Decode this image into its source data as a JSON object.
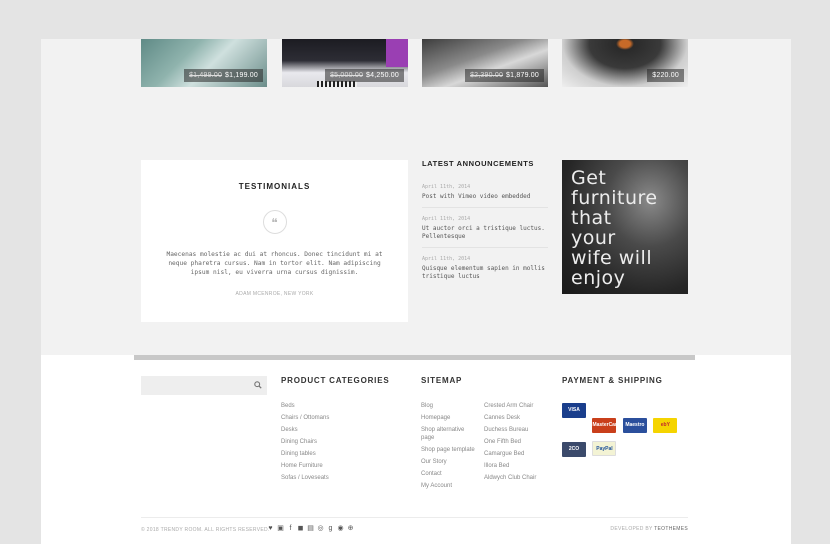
{
  "products": [
    {
      "old_price": "$1,499.00",
      "price": "$1,199.00"
    },
    {
      "old_price": "$5,000.00",
      "price": "$4,250.00"
    },
    {
      "old_price": "$2,390.00",
      "price": "$1,879.00"
    },
    {
      "old_price": "",
      "price": "$220.00"
    }
  ],
  "testimonials": {
    "title": "TESTIMONIALS",
    "quote_glyph": "❝",
    "text": "Maecenas molestie ac dui at rhoncus. Donec tincidunt mi at neque pharetra cursus. Nam in tortor elit. Nam adipiscing ipsum nisl, eu viverra urna cursus dignissim.",
    "author": "ADAM MCENROE, NEW YORK"
  },
  "announcements": {
    "title": "LATEST ANNOUNCEMENTS",
    "items": [
      {
        "date": "April 11th, 2014",
        "title": "Post with Vimeo video embedded"
      },
      {
        "date": "April 11th, 2014",
        "title": "Ut auctor orci a tristique luctus. Pellentesque"
      },
      {
        "date": "April 11th, 2014",
        "title": "Quisque elementum sapien in mollis tristique luctus"
      }
    ]
  },
  "promo": {
    "lines": [
      "Get",
      "furniture",
      "that",
      "your",
      "wife will",
      "enjoy"
    ]
  },
  "footer": {
    "search_placeholder": "",
    "product_categories": {
      "title": "PRODUCT CATEGORIES",
      "items": [
        "Beds",
        "Chairs / Ottomans",
        "Desks",
        "Dining Chairs",
        "Dining tables",
        "Home Furniture",
        "Sofas / Loveseats"
      ]
    },
    "sitemap": {
      "title": "SITEMAP",
      "col1": [
        "Blog",
        "Homepage",
        "Shop alternative page",
        "Shop page template",
        "Our Story",
        "Contact",
        "My Account"
      ],
      "col2": [
        "Crested Arm Chair",
        "Cannes Desk",
        "Duchess Bureau",
        "One Fifth Bed",
        "Camargue Bed",
        "Illora Bed",
        "Aldwych Club Chair"
      ]
    },
    "payment": {
      "title": "PAYMENT & SHIPPING",
      "cards": [
        {
          "name": "VISA Electron",
          "color": "#1a3e8c"
        },
        {
          "name": "MasterCard",
          "color": "#c93f1b"
        },
        {
          "name": "Maestro",
          "color": "#2b4f9c"
        },
        {
          "name": "ebY",
          "color": "#f5d400"
        },
        {
          "name": "2CO",
          "color": "#3b4a6b"
        },
        {
          "name": "PayPal",
          "color": "#f3f3d4"
        }
      ]
    },
    "copyright": "© 2018 TRENDY ROOM. ALL RIGHTS RESERVED.",
    "socials": [
      "twitter-icon",
      "instagram-icon",
      "facebook-icon",
      "flickr-icon",
      "vimeo-icon",
      "dribbble-icon",
      "google-plus-icon",
      "rss-icon",
      "pinterest-icon"
    ],
    "developed_by_label": "DEVELOPED BY",
    "developer": "TEOTHEMES"
  }
}
